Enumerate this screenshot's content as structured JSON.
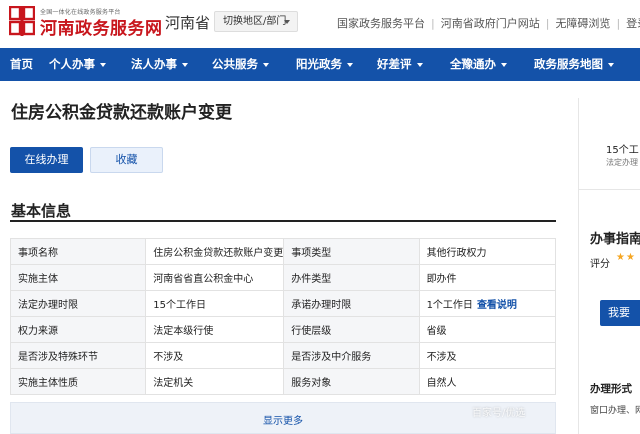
{
  "header": {
    "logo_small": "全国一体化在线政务服务平台",
    "logo_text": "河南政务服务网",
    "province": "河南省",
    "switch_label": "切换地区/部门",
    "links": [
      "国家政务服务平台",
      "河南省政府门户网站",
      "无障碍浏览",
      "登录"
    ]
  },
  "nav": {
    "items": [
      "首页",
      "个人办事",
      "法人办事",
      "公共服务",
      "阳光政务",
      "好差评",
      "全豫通办",
      "政务服务地图"
    ]
  },
  "main": {
    "title": "住房公积金贷款还款账户变更",
    "btn_online": "在线办理",
    "btn_fav": "收藏",
    "section_title": "基本信息",
    "rows": [
      [
        "事项名称",
        "住房公积金贷款还款账户变更",
        "事项类型",
        "其他行政权力"
      ],
      [
        "实施主体",
        "河南省省直公积金中心",
        "办件类型",
        "即办件"
      ],
      [
        "法定办理时限",
        "15个工作日",
        "承诺办理时限",
        "1个工作日"
      ],
      [
        "权力来源",
        "法定本级行使",
        "行使层级",
        "省级"
      ],
      [
        "是否涉及特殊环节",
        "不涉及",
        "是否涉及中介服务",
        "不涉及"
      ],
      [
        "实施主体性质",
        "法定机关",
        "服务对象",
        "自然人"
      ]
    ],
    "view_note": "查看说明",
    "show_more": "显示更多"
  },
  "right": {
    "days": "15个工",
    "days_sub": "法定办理",
    "guide": "办事指南",
    "score": "评分",
    "stars": "★★",
    "login_btn": "我要",
    "form_title": "办理形式",
    "form_val": "窗口办理、网"
  },
  "watermark": "百家号/优选",
  "colors": {
    "primary": "#1452a9",
    "brand_red": "#c8161d"
  }
}
